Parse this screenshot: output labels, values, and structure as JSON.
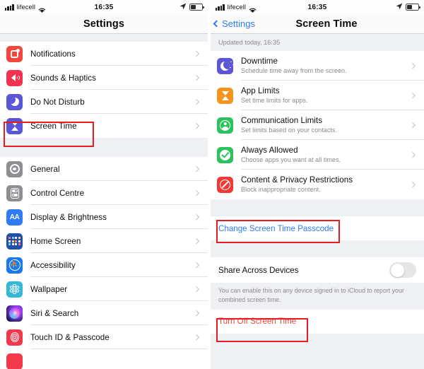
{
  "left_panel": {
    "status_bar": {
      "carrier": "lifecell",
      "time": "16:35",
      "signal_icon": "cellular-bars-icon",
      "wifi_icon": "wifi-icon",
      "location_icon": "location-arrow-icon",
      "battery_icon": "battery-icon"
    },
    "nav": {
      "title": "Settings"
    },
    "groups": [
      {
        "rows": [
          {
            "label": "Notifications",
            "icon": "notifications-icon"
          },
          {
            "label": "Sounds & Haptics",
            "icon": "sounds-haptics-icon"
          },
          {
            "label": "Do Not Disturb",
            "icon": "do-not-disturb-icon"
          },
          {
            "label": "Screen Time",
            "icon": "screen-time-icon"
          }
        ]
      },
      {
        "rows": [
          {
            "label": "General",
            "icon": "general-gear-icon"
          },
          {
            "label": "Control Centre",
            "icon": "control-centre-icon"
          },
          {
            "label": "Display & Brightness",
            "icon": "display-brightness-icon"
          },
          {
            "label": "Home Screen",
            "icon": "home-screen-icon"
          },
          {
            "label": "Accessibility",
            "icon": "accessibility-icon"
          },
          {
            "label": "Wallpaper",
            "icon": "wallpaper-icon"
          },
          {
            "label": "Siri & Search",
            "icon": "siri-search-icon"
          },
          {
            "label": "Touch ID & Passcode",
            "icon": "touch-id-passcode-icon"
          }
        ]
      }
    ],
    "highlight": {
      "target": "Screen Time",
      "color": "#e81c20"
    }
  },
  "right_panel": {
    "status_bar": {
      "carrier": "lifecell",
      "time": "16:35",
      "signal_icon": "cellular-bars-icon",
      "wifi_icon": "wifi-icon",
      "location_icon": "location-arrow-icon",
      "battery_icon": "battery-icon"
    },
    "nav": {
      "back_label": "Settings",
      "title": "Screen Time"
    },
    "updated_note": "Updated today, 16:35",
    "feature_rows": [
      {
        "title": "Downtime",
        "subtitle": "Schedule time away from the screen.",
        "icon": "downtime-icon"
      },
      {
        "title": "App Limits",
        "subtitle": "Set time limits for apps.",
        "icon": "app-limits-icon"
      },
      {
        "title": "Communication Limits",
        "subtitle": "Set limits based on your contacts.",
        "icon": "communication-limits-icon"
      },
      {
        "title": "Always Allowed",
        "subtitle": "Choose apps you want at all times.",
        "icon": "always-allowed-icon"
      },
      {
        "title": "Content & Privacy Restrictions",
        "subtitle": "Block inappropriate content.",
        "icon": "content-privacy-icon"
      }
    ],
    "passcode_link": "Change Screen Time Passcode",
    "share": {
      "label": "Share Across Devices",
      "toggle_state": "off",
      "footnote": "You can enable this on any device signed in to iCloud to report your combined screen time."
    },
    "turn_off_link": "Turn Off Screen Time",
    "highlights": [
      {
        "target": "Change Screen Time Passcode",
        "color": "#e81c20"
      },
      {
        "target": "Turn Off Screen Time",
        "color": "#e81c20"
      }
    ]
  },
  "colors": {
    "accent_blue": "#2e7bf6",
    "destructive_red": "#e8483f",
    "annotation_red": "#e81c20",
    "group_bg": "#eff0f4"
  }
}
